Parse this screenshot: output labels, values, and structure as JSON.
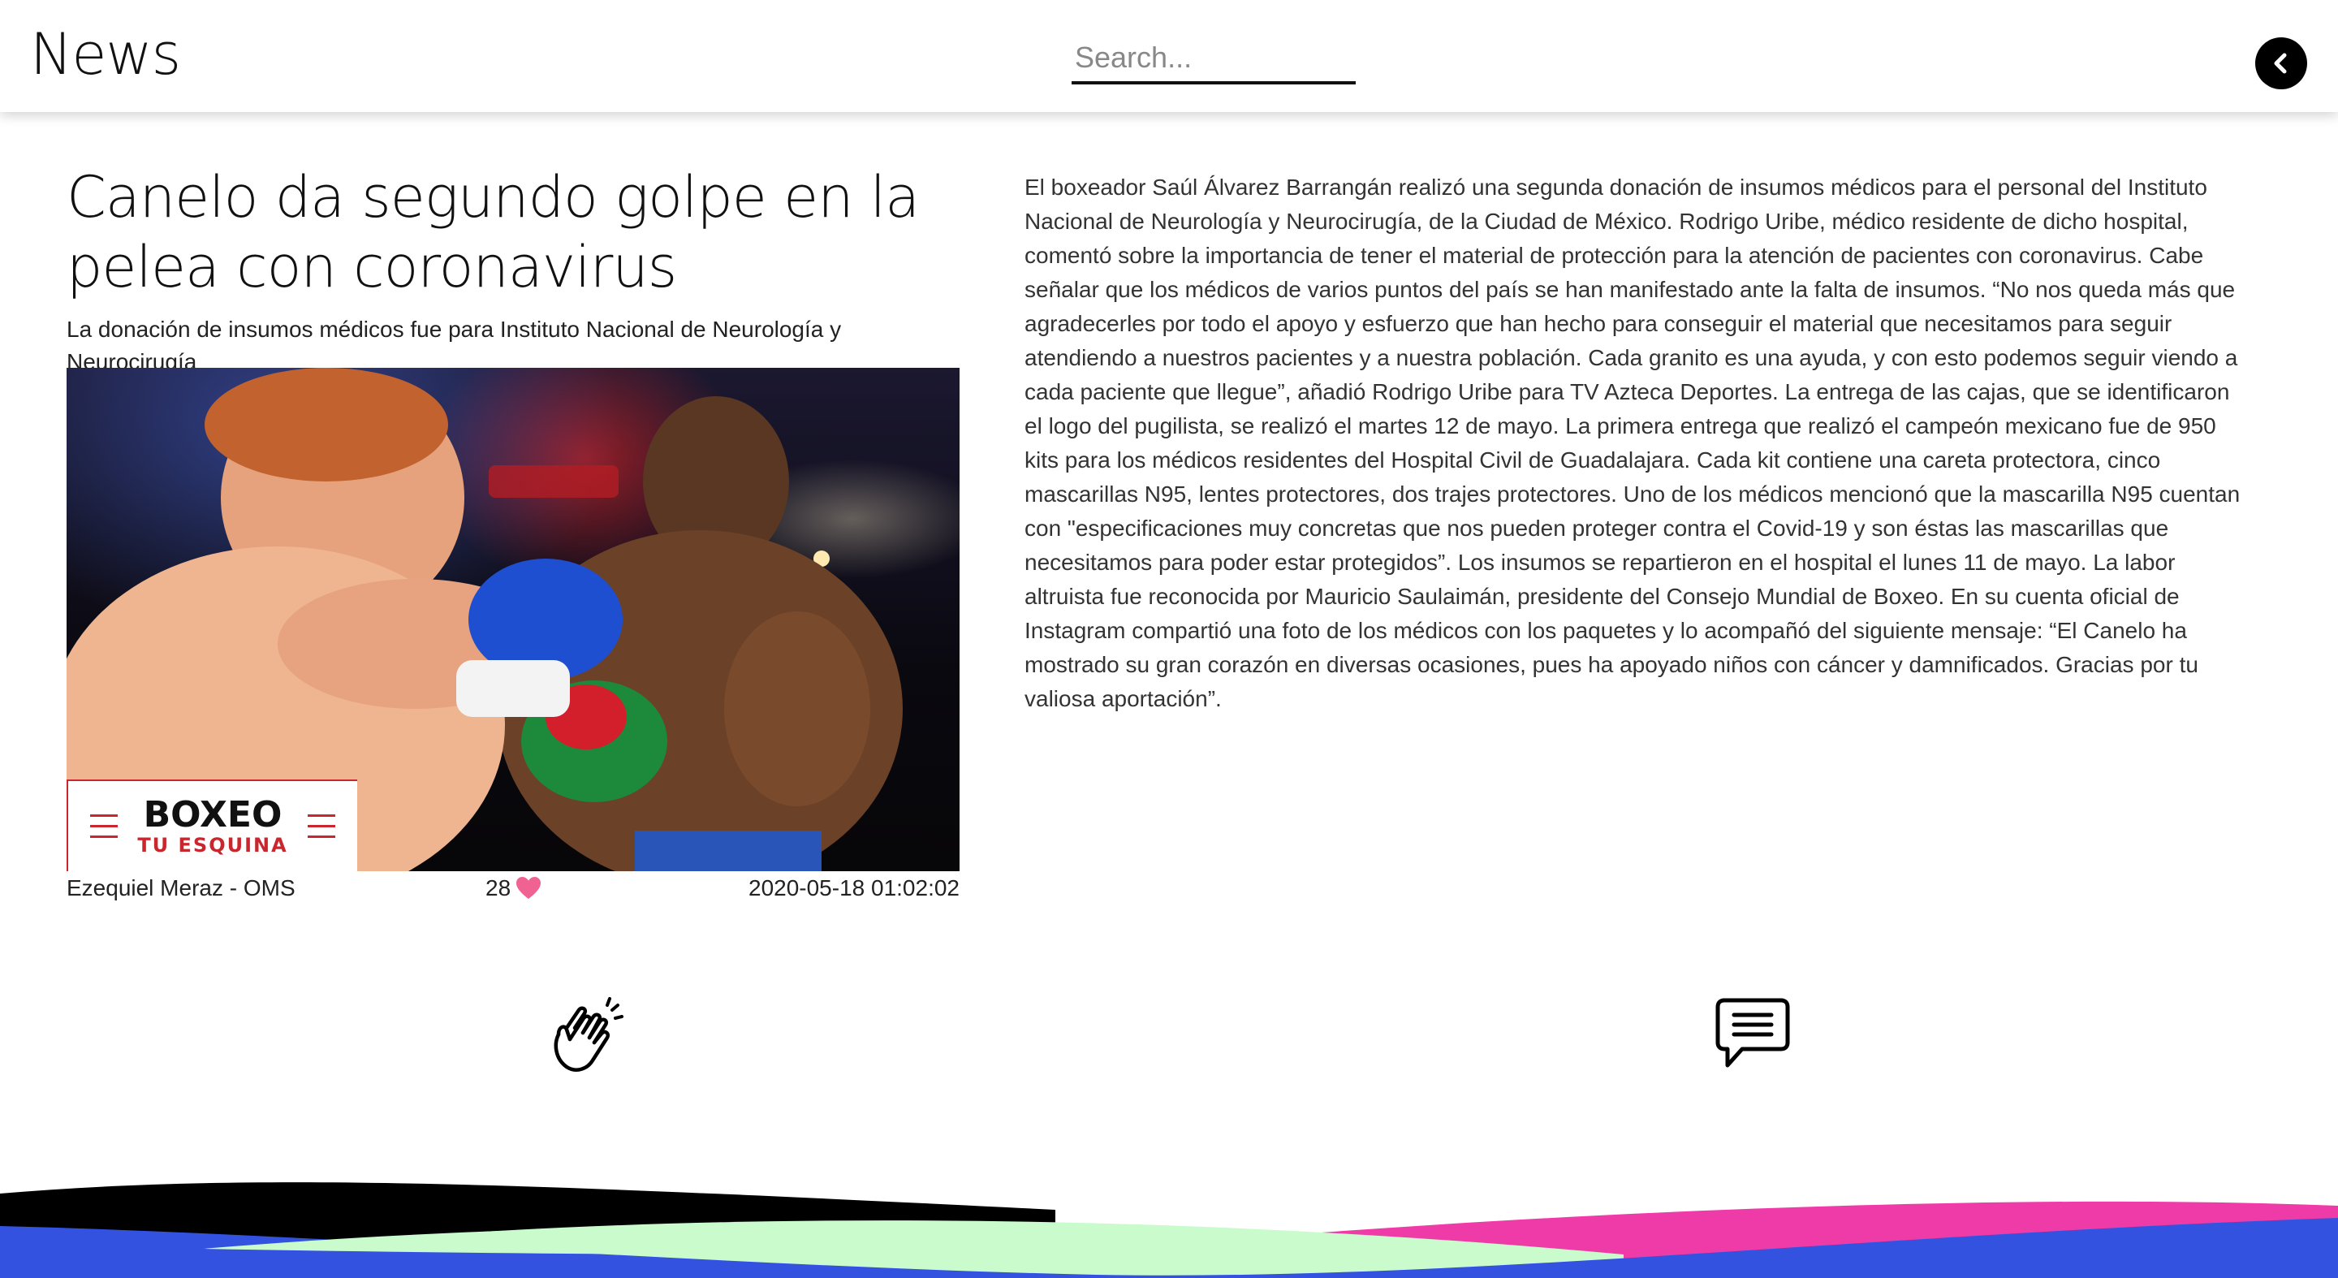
{
  "header": {
    "brand": "News",
    "search_placeholder": "Search...",
    "back_icon": "chevron-left-icon"
  },
  "article": {
    "title": "Canelo da segundo golpe en la pelea con coronavirus",
    "subtitle": "La donación de insumos médicos fue para Instituto Nacional de Neurología y Neurocirugía",
    "image_badge": {
      "main": "BOXEO",
      "sub": "TU ESQUINA"
    },
    "author": "Ezequiel Meraz - OMS",
    "likes": "28",
    "date": "2020-05-18 01:02:02",
    "body": "El boxeador Saúl Álvarez Barrangán realizó una segunda donación de insumos médicos para el personal del Instituto Nacional de Neurología y Neurocirugía, de la Ciudad de México. Rodrigo Uribe, médico residente de dicho hospital, comentó sobre la importancia de tener el material de protección para la atención de pacientes con coronavirus. Cabe señalar que los médicos de varios puntos del país se han manifestado ante la falta de insumos. “No nos queda más que agradecerles por todo el apoyo y esfuerzo que han hecho para conseguir el material que necesitamos para seguir atendiendo a nuestros pacientes y a nuestra población. Cada granito es una ayuda, y con esto podemos seguir viendo a cada paciente que llegue”, añadió Rodrigo Uribe para TV Azteca Deportes. La entrega de las cajas, que se identificaron el logo del pugilista, se realizó el martes 12 de mayo. La primera entrega que realizó el campeón mexicano fue de 950 kits para los médicos residentes del Hospital Civil de Guadalajara. Cada kit contiene una careta protectora, cinco mascarillas N95, lentes protectores, dos trajes protectores. Uno de los médicos mencionó que la mascarilla N95 cuentan con \"especificaciones muy concretas que nos pueden proteger contra el Covid-19 y son éstas las mascarillas que necesitamos para poder estar protegidos”. Los insumos se repartieron en el hospital el lunes 11 de mayo. La labor altruista fue reconocida por Mauricio Saulaimán, presidente del Consejo Mundial de Boxeo. En su cuenta oficial de Instagram compartió una foto de los médicos con los paquetes y lo acompañó del siguiente mensaje: “El Canelo ha mostrado su gran corazón en diversas ocasiones, pues ha apoyado niños con cáncer y damnificados. Gracias por tu valiosa aportación”."
  },
  "actions": {
    "clap_icon": "clapping-hands-icon",
    "comment_icon": "comment-bubble-icon",
    "heart_icon": "heart-icon"
  },
  "colors": {
    "heart": "#f06292",
    "wave_blue": "#3452e0",
    "wave_mint": "#c9fbcc",
    "wave_pink": "#ee3ba8",
    "wave_black": "#000000",
    "logo_red": "#c9272d"
  }
}
